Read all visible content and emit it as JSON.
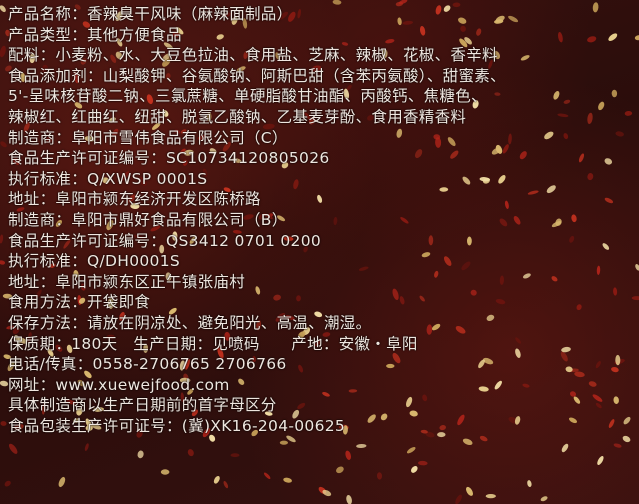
{
  "label": {
    "lines": [
      "产品名称：香辣臭干风味（麻辣面制品）",
      "产品类型：其他方便食品",
      "配料：小麦粉、水、大豆色拉油、食用盐、芝麻、辣椒、花椒、香辛料",
      "食品添加剂：山梨酸钾、谷氨酸钠、阿斯巴甜（含苯丙氨酸）、甜蜜素、",
      "5'-呈味核苷酸二钠、三氯蔗糖、单硬脂酸甘油酯、丙酸钙、焦糖色、",
      "辣椒红、红曲红、纽甜、脱氢乙酸钠、乙基麦芽酚、食用香精香料",
      "制造商：阜阳市雪伟食品有限公司（C）",
      "食品生产许可证编号：SC10734120805026",
      "执行标准：Q/XWSP 0001S",
      "地址：阜阳市颍东经济开发区陈桥路",
      "制造商：阜阳市鼎好食品有限公司（B）",
      "食品生产许可证编号：QS3412 0701 0200",
      "执行标准：Q/DH0001S",
      "地址：阜阳市颍东区正午镇张庙村",
      "食用方法：开袋即食",
      "保存方法：请放在阴凉处、避免阳光、高温、潮湿。",
      "保质期：180天　生产日期：见喷码　　产地：安徽・阜阳",
      "电话/传真：0558-2706765 2706766",
      "网址：www.xuewejfood.com",
      "具体制造商以生产日期前的首字母区分",
      "食品包装生产许可证号：(冀)XK16-204-00625"
    ]
  }
}
